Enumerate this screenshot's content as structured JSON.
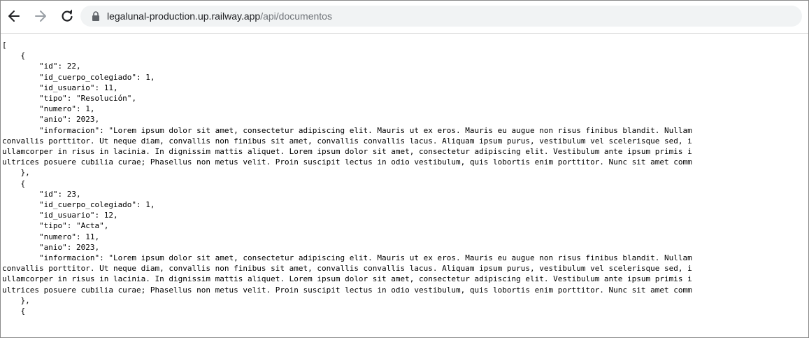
{
  "browser": {
    "url_host": "legalunal-production.up.railway.app",
    "url_path": "/api/documentos"
  },
  "json_lines": [
    "[",
    "    {",
    "        \"id\": 22,",
    "        \"id_cuerpo_colegiado\": 1,",
    "        \"id_usuario\": 11,",
    "        \"tipo\": \"Resolución\",",
    "        \"numero\": 1,",
    "        \"anio\": 2023,",
    "        \"informacion\": \"Lorem ipsum dolor sit amet, consectetur adipiscing elit. Mauris ut ex eros. Mauris eu augue non risus finibus blandit. Nullam",
    "convallis porttitor. Ut neque diam, convallis non finibus sit amet, convallis convallis lacus. Aliquam ipsum purus, vestibulum vel scelerisque sed, i",
    "ullamcorper in risus in lacinia. In dignissim mattis aliquet. Lorem ipsum dolor sit amet, consectetur adipiscing elit. Vestibulum ante ipsum primis i",
    "ultrices posuere cubilia curae; Phasellus non metus velit. Proin suscipit lectus in odio vestibulum, quis lobortis enim porttitor. Nunc sit amet comm",
    "    },",
    "    {",
    "        \"id\": 23,",
    "        \"id_cuerpo_colegiado\": 1,",
    "        \"id_usuario\": 12,",
    "        \"tipo\": \"Acta\",",
    "        \"numero\": 11,",
    "        \"anio\": 2023,",
    "        \"informacion\": \"Lorem ipsum dolor sit amet, consectetur adipiscing elit. Mauris ut ex eros. Mauris eu augue non risus finibus blandit. Nullam",
    "convallis porttitor. Ut neque diam, convallis non finibus sit amet, convallis convallis lacus. Aliquam ipsum purus, vestibulum vel scelerisque sed, i",
    "ullamcorper in risus in lacinia. In dignissim mattis aliquet. Lorem ipsum dolor sit amet, consectetur adipiscing elit. Vestibulum ante ipsum primis i",
    "ultrices posuere cubilia curae; Phasellus non metus velit. Proin suscipit lectus in odio vestibulum, quis lobortis enim porttitor. Nunc sit amet comm",
    "    },",
    "    {"
  ],
  "icons": {
    "back": "arrow-left-icon",
    "forward": "arrow-right-icon",
    "reload": "reload-icon",
    "lock": "lock-icon"
  }
}
